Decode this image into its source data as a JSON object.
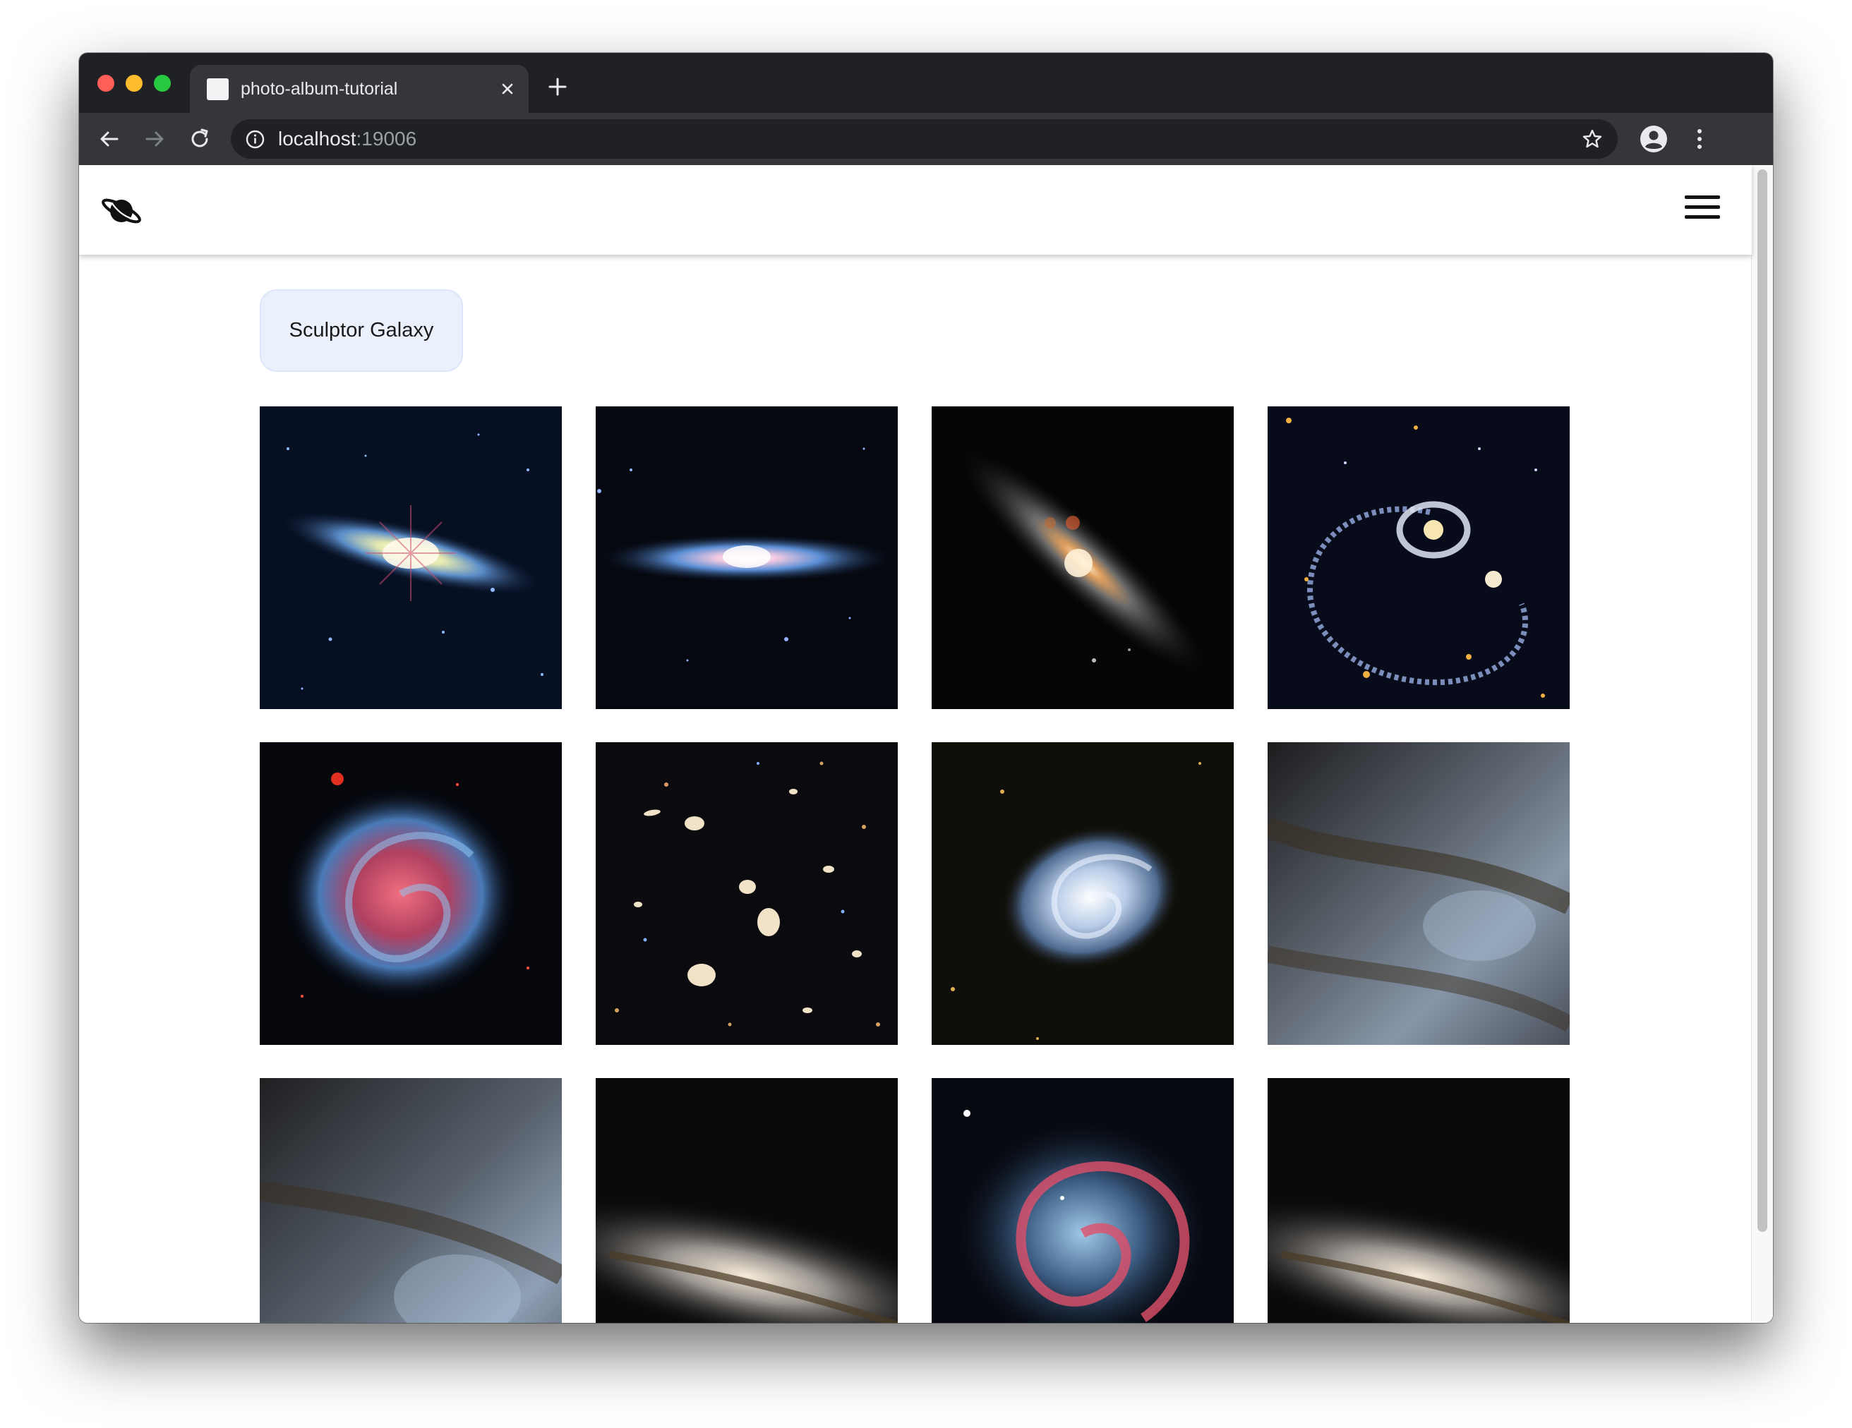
{
  "browser": {
    "tab_title": "photo-album-tutorial",
    "url_host": "localhost",
    "url_port": ":19006"
  },
  "icons": {
    "logo": "planet-icon",
    "menu": "hamburger-menu-icon",
    "back": "arrow-left-icon",
    "forward": "arrow-right-icon",
    "reload": "reload-icon",
    "site_info": "info-icon",
    "bookmark": "star-icon",
    "profile": "profile-icon",
    "browser_menu": "more-vert-icon",
    "tab_close": "close-icon",
    "new_tab": "plus-icon"
  },
  "album": {
    "title": "Sculptor Galaxy"
  },
  "gallery": {
    "photos": [
      {
        "subject": "edge-on spiral galaxy with diffraction spikes"
      },
      {
        "subject": "edge-on spiral galaxy, blue and pink"
      },
      {
        "subject": "dusty edge-on galaxy with bright core"
      },
      {
        "subject": "ring galaxy with extended spiral arm"
      },
      {
        "subject": "face-on spiral galaxy, red and blue"
      },
      {
        "subject": "galaxy cluster field"
      },
      {
        "subject": "face-on spiral galaxy, white arms"
      },
      {
        "subject": "galaxy star field close-up"
      },
      {
        "subject": "galaxy star field close-up"
      },
      {
        "subject": "dusty galaxy disk"
      },
      {
        "subject": "infrared spiral galaxy"
      },
      {
        "subject": "dusty galaxy disk"
      }
    ]
  },
  "colors": {
    "chip_background": "#ebf0fd",
    "browser_frame": "#202124",
    "toolbar": "#35363a"
  }
}
